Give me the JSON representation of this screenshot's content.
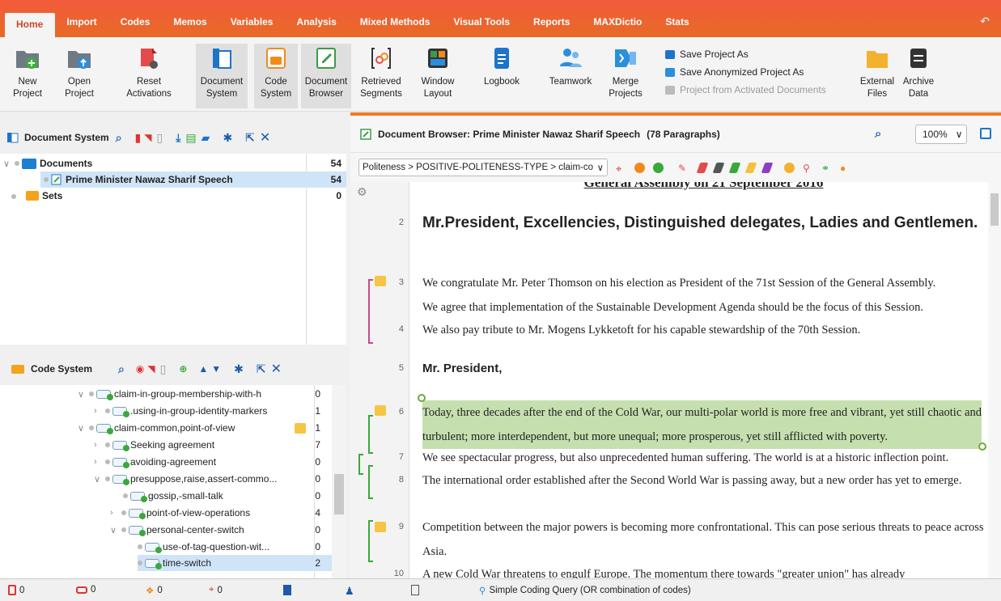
{
  "tabs": [
    "Home",
    "Import",
    "Codes",
    "Memos",
    "Variables",
    "Analysis",
    "Mixed Methods",
    "Visual Tools",
    "Reports",
    "MAXDictio",
    "Stats"
  ],
  "ribbon": {
    "new_project": [
      "New",
      "Project"
    ],
    "open_project": [
      "Open",
      "Project"
    ],
    "reset_activations": [
      "Reset",
      "Activations"
    ],
    "document_system": [
      "Document",
      "System"
    ],
    "code_system": [
      "Code",
      "System"
    ],
    "document_browser": [
      "Document",
      "Browser"
    ],
    "retrieved_segments": [
      "Retrieved",
      "Segments"
    ],
    "window_layout": [
      "Window",
      "Layout"
    ],
    "logbook": [
      "Logbook",
      ""
    ],
    "teamwork": [
      "Teamwork",
      ""
    ],
    "merge_projects": [
      "Merge",
      "Projects"
    ],
    "save_project_as": "Save Project As",
    "save_anonymized": "Save Anonymized Project As",
    "project_from_activated": "Project from Activated Documents",
    "external_files": [
      "External",
      "Files"
    ],
    "archive_data": [
      "Archive",
      "Data"
    ]
  },
  "document_system": {
    "title": "Document System",
    "rows": [
      {
        "label": "Documents",
        "count": "54"
      },
      {
        "label": "Prime Minister Nawaz Sharif Speech",
        "count": "54"
      },
      {
        "label": "Sets",
        "count": "0"
      }
    ]
  },
  "code_system": {
    "title": "Code System",
    "rows": [
      {
        "label": "claim-in-group-membership-with-h",
        "count": "0"
      },
      {
        "label": ".using-in-group-identity-markers",
        "count": "1"
      },
      {
        "label": "claim-common,point-of-view",
        "count": "1"
      },
      {
        "label": "Seeking agreement",
        "count": "7"
      },
      {
        "label": "avoiding-agreement",
        "count": "0"
      },
      {
        "label": "presuppose,raise,assert-commo...",
        "count": "0"
      },
      {
        "label": "gossip,-small-talk",
        "count": "0"
      },
      {
        "label": "point-of-view-operations",
        "count": "4"
      },
      {
        "label": "personal-center-switch",
        "count": "0"
      },
      {
        "label": "use-of-tag-question-wit...",
        "count": "0"
      },
      {
        "label": "time-switch",
        "count": "2"
      }
    ]
  },
  "doc_browser": {
    "title": "Document Browser: Prime Minister Nawaz Sharif Speech",
    "para_count": "(78 Paragraphs)",
    "zoom": "100%",
    "code_path": "Politeness > POSITIVE-POLITENESS-TYPE > claim-co",
    "header_text": "General Assembly on 21 September 2016",
    "paragraphs": [
      {
        "n": "2",
        "text": "Mr.President, Excellencies, Distinguished delegates, Ladies and Gentlemen."
      },
      {
        "n": "3",
        "text": "We congratulate Mr. Peter Thomson on his election as President of the 71st Session of the General Assembly."
      },
      {
        "n": "",
        "text": "We agree that implementation of the Sustainable Development Agenda should be the focus of this Session."
      },
      {
        "n": "4",
        "text": "We also pay tribute to Mr. Mogens Lykketoft for his capable stewardship of the 70th Session."
      },
      {
        "n": "5",
        "text": "Mr. President,"
      },
      {
        "n": "6",
        "text": "Today, three decades after the end of the Cold War, our multi-polar world is more free and vibrant, yet still chaotic and turbulent; more interdependent, but more unequal; more prosperous, yet still afflicted with poverty."
      },
      {
        "n": "7",
        "text": "We see spectacular progress, but also unprecedented human suffering. The world is at a historic inflection point."
      },
      {
        "n": "8",
        "text": "The international order established after the Second World War is passing away, but a new order has yet to emerge."
      },
      {
        "n": "9",
        "text": "Competition between the major powers is becoming more confrontational. This can pose serious threats to peace across Asia."
      },
      {
        "n": "10",
        "text": "A new Cold War threatens to engulf Europe. The momentum there towards \"greater union\" has already"
      }
    ]
  },
  "status": {
    "s1": "0",
    "s2": "0",
    "s3": "0",
    "s4": "0",
    "query": "Simple Coding Query (OR combination of codes)"
  }
}
